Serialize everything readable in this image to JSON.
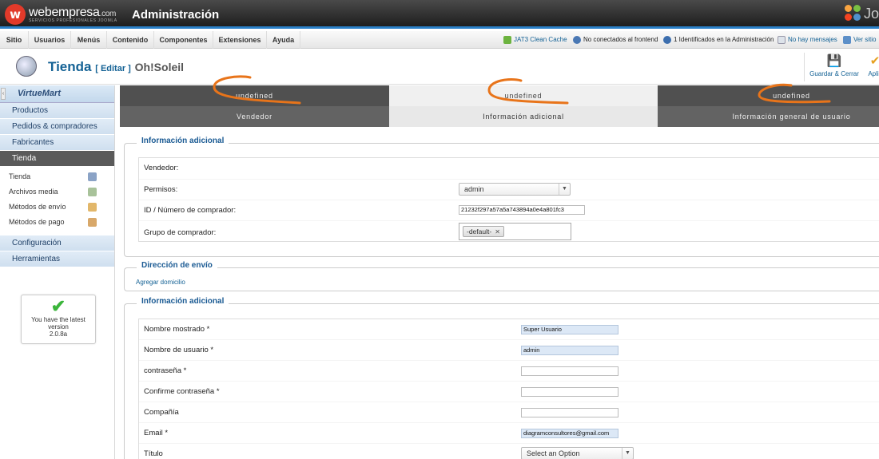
{
  "header": {
    "brand": "webempresa",
    "brand_suffix": ".com",
    "brand_tagline": "SERVICIOS PROFESIONALES JOOMLA",
    "title": "Administración",
    "right_brand": "Jo"
  },
  "menu": {
    "items": [
      "Sitio",
      "Usuarios",
      "Menús",
      "Contenido",
      "Componentes",
      "Extensiones",
      "Ayuda"
    ],
    "status": [
      {
        "label": "JAT3 Clean Cache",
        "icon": "cache-icon"
      },
      {
        "label": "No conectados al frontend",
        "icon": "users-icon"
      },
      {
        "label": "1 Identificados en la Administración",
        "icon": "user-icon"
      },
      {
        "label": "No hay mensajes",
        "icon": "message-icon"
      },
      {
        "label": "Ver sitio",
        "icon": "view-site-icon"
      }
    ]
  },
  "toolbar": {
    "title": "Tienda",
    "edit_label": "[ Editar ]",
    "store_name": "Oh!Soleil",
    "save_close_label": "Guardar & Cerrar",
    "apply_label": "Aplic"
  },
  "sidebar": {
    "logo": "VirtueMart",
    "collapse_label": "‹",
    "sections": [
      "Productos",
      "Pedidos & compradores",
      "Fabricantes",
      "Tienda",
      "Configuración",
      "Herramientas"
    ],
    "active_section": "Tienda",
    "sub_items": [
      "Tienda",
      "Archivos media",
      "Métodos de envío",
      "Métodos de pago"
    ],
    "version_line1": "You have the latest",
    "version_line2": "version",
    "version_number": "2.0.8a"
  },
  "tabs": {
    "row1": [
      "undefined",
      "undefined",
      "undefined"
    ],
    "row2": [
      "Vendedor",
      "Información adicional",
      "Información general de usuario"
    ],
    "selected_index": 1
  },
  "section1": {
    "title": "Información adicional",
    "vendor_label": "Vendedor:",
    "permissions_label": "Permisos:",
    "permissions_value": "admin",
    "customer_id_label": "ID / Número de comprador:",
    "customer_id_value": "21232f297a57a5a743894a0e4a801fc3",
    "group_label": "Grupo de comprador:",
    "group_chip": "-default-"
  },
  "section2": {
    "title": "Dirección de envío",
    "add_address_link": "Agregar domicilio"
  },
  "section3": {
    "title": "Información adicional",
    "fields": [
      {
        "label": "Nombre mostrado *",
        "value": "Super Usuario"
      },
      {
        "label": "Nombre de usuario *",
        "value": "admin"
      },
      {
        "label": "contraseña *",
        "value": ""
      },
      {
        "label": "Confirme contraseña *",
        "value": ""
      },
      {
        "label": "Compañía",
        "value": ""
      },
      {
        "label": "Email *",
        "value": "diagramconsultores@gmail.com"
      },
      {
        "label": "Título",
        "select": "Select an Option"
      }
    ]
  },
  "colors": {
    "accent_blue": "#146295",
    "scribble_orange": "#e8741a",
    "active_section_bg": "#5a5a5a"
  }
}
